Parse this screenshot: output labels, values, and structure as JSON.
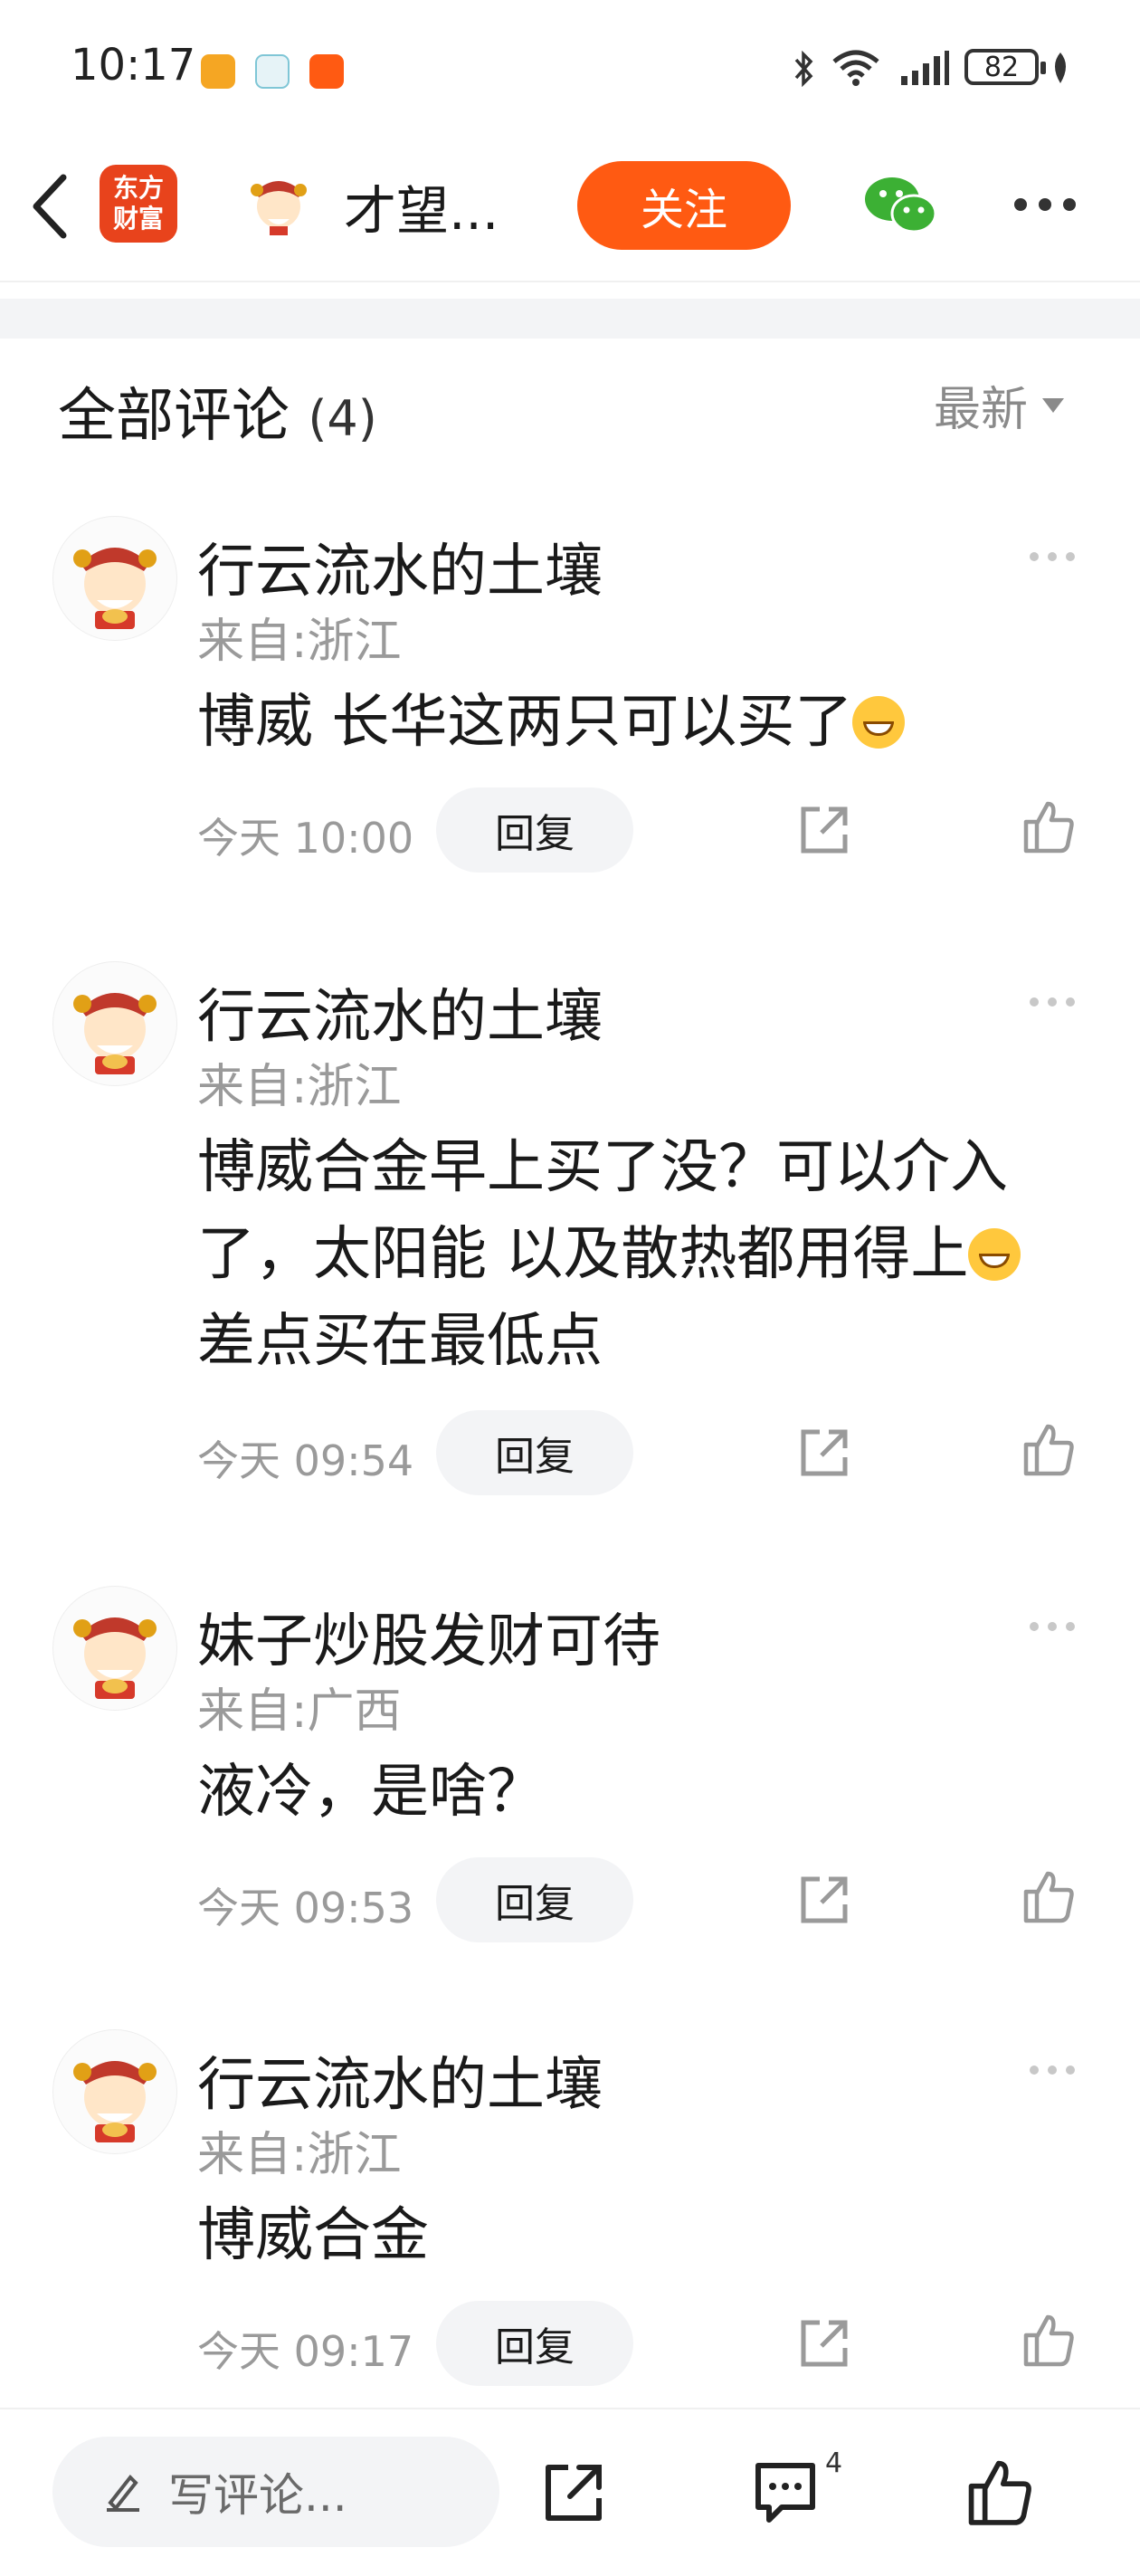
{
  "status_bar": {
    "time": "10:17",
    "battery": "82",
    "app_icon_colors": [
      "#f5a623",
      "#7fc6d6",
      "#ff5a12"
    ]
  },
  "nav": {
    "back_icon": "chevron-left-icon",
    "logo_line1": "东方",
    "logo_line2": "财富",
    "title": "才望...",
    "follow_label": "关注",
    "wechat_icon": "wechat-icon",
    "more_icon": "more-horizontal-icon"
  },
  "comments_header": {
    "title": "全部评论",
    "count": "(4)",
    "sort_label": "最新"
  },
  "comments": [
    {
      "user": "行云流水的土壤",
      "location": "来自:浙江",
      "text": "博威  长华这两只可以买了",
      "time": "今天 10:00",
      "reply_label": "回复"
    },
    {
      "user": "行云流水的土壤",
      "location": "来自:浙江",
      "text_line1": "博威合金早上买了没？可以介入",
      "text_line2": "了，太阳能 以及散热都用得上",
      "text_line3": "差点买在最低点",
      "time": "今天 09:54",
      "reply_label": "回复"
    },
    {
      "user": "妹子炒股发财可待",
      "location": "来自:广西",
      "text": "液冷，是啥？",
      "time": "今天 09:53",
      "reply_label": "回复"
    },
    {
      "user": "行云流水的土壤",
      "location": "来自:浙江",
      "text": "博威合金",
      "time": "今天 09:17",
      "reply_label": "回复"
    }
  ],
  "bottom_bar": {
    "write_placeholder": "写评论...",
    "comment_count": "4"
  },
  "colors": {
    "accent": "#ff5a12",
    "brand": "#e8431c",
    "wechat": "#3cb034",
    "muted": "#9a9a9a"
  }
}
